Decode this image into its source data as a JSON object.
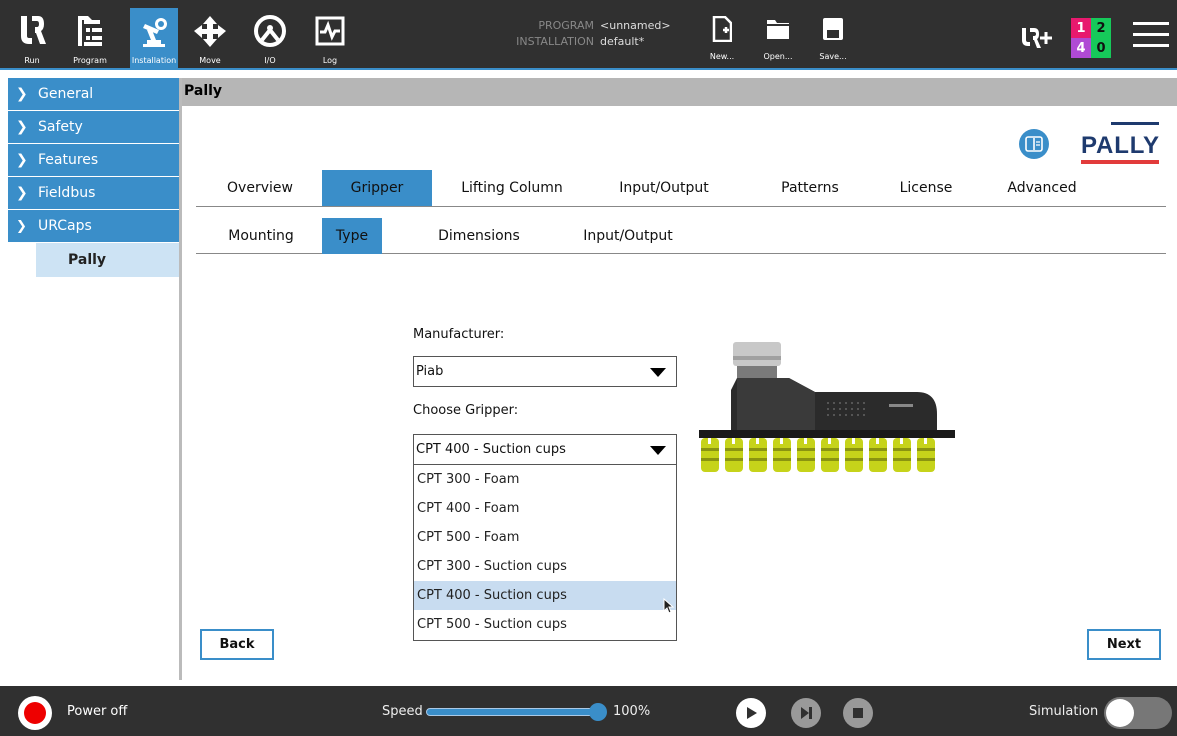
{
  "nav": {
    "items": [
      {
        "label": "Run",
        "icon": "ur-logo-icon"
      },
      {
        "label": "Program",
        "icon": "program-tree-icon"
      },
      {
        "label": "Installation",
        "icon": "robot-arm-icon"
      },
      {
        "label": "Move",
        "icon": "move-arrows-icon"
      },
      {
        "label": "I/O",
        "icon": "io-icon"
      },
      {
        "label": "Log",
        "icon": "log-chart-icon"
      }
    ],
    "active": "Installation"
  },
  "program_info": {
    "program_key": "PROGRAM",
    "program_value": "<unnamed>",
    "installation_key": "INSTALLATION",
    "installation_value": "default*"
  },
  "file_buttons": {
    "new": "New...",
    "open": "Open...",
    "save": "Save..."
  },
  "io_counts": {
    "a": "1",
    "b": "2",
    "c": "4",
    "d": "0",
    "colors": {
      "a": "#e8196e",
      "b": "#16c95a",
      "c": "#b04ad4",
      "d": "#16c95a"
    }
  },
  "sidebar": {
    "items": [
      {
        "label": "General",
        "chevron": ">"
      },
      {
        "label": "Safety",
        "chevron": ">"
      },
      {
        "label": "Features",
        "chevron": ">"
      },
      {
        "label": "Fieldbus",
        "chevron": ">"
      },
      {
        "label": "URCaps",
        "chevron": "v"
      }
    ],
    "subitem": "Pally"
  },
  "page_title": "Pally",
  "logo_text": "PALLY",
  "main_tabs": [
    "Overview",
    "Gripper",
    "Lifting Column",
    "Input/Output",
    "Patterns",
    "License",
    "Advanced"
  ],
  "main_tab_active": "Gripper",
  "sub_tabs": [
    "Mounting",
    "Type",
    "Dimensions",
    "Input/Output"
  ],
  "sub_tab_active": "Type",
  "form": {
    "manufacturer_label": "Manufacturer:",
    "manufacturer_value": "Piab",
    "gripper_label": "Choose Gripper:",
    "gripper_value": "CPT 400 - Suction cups",
    "gripper_options": [
      "CPT 300 - Foam",
      "CPT 400 - Foam",
      "CPT 500 - Foam",
      "CPT 300 - Suction cups",
      "CPT 400 - Suction cups",
      "CPT 500 - Suction cups"
    ],
    "gripper_highlighted": "CPT 400 - Suction cups"
  },
  "buttons": {
    "back": "Back",
    "next": "Next"
  },
  "bottom": {
    "power_label": "Power off",
    "speed_label": "Speed",
    "speed_value": "100%",
    "speed_fraction": 1.0,
    "simulation_label": "Simulation",
    "simulation_on": false
  },
  "colors": {
    "accent": "#3a8ec9",
    "bar": "#303030",
    "title_bar": "#b6b6b6",
    "power": "#e00000"
  }
}
